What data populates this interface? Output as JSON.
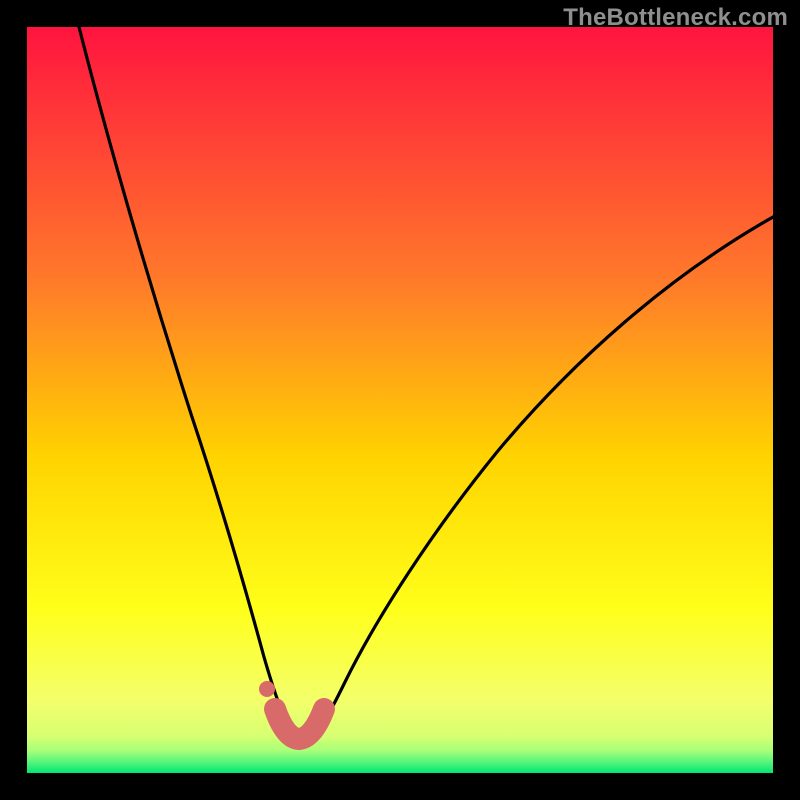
{
  "attribution": "TheBottleneck.com",
  "colors": {
    "black_frame": "#000000",
    "gradient_top": "#ff143f",
    "gradient_mid1": "#ff7a2a",
    "gradient_mid2": "#ffd400",
    "gradient_mid3": "#ffff1a",
    "gradient_low": "#f4ff6a",
    "gradient_green": "#00e873",
    "curve": "#000000",
    "marker": "#d86b6a"
  },
  "chart_data": {
    "type": "line",
    "title": "",
    "xlabel": "",
    "ylabel": "",
    "xlim": [
      0,
      100
    ],
    "ylim": [
      0,
      100
    ],
    "series": [
      {
        "name": "bottleneck-curve",
        "x": [
          7,
          10,
          14,
          18,
          22,
          25,
          28,
          30,
          32,
          33.5,
          35,
          36.5,
          38,
          40,
          43,
          48,
          55,
          63,
          72,
          82,
          92,
          100
        ],
        "y": [
          100,
          90,
          78,
          65,
          50,
          38,
          26,
          18,
          11,
          7,
          5,
          5,
          7,
          11,
          18,
          27,
          36,
          45,
          54,
          62,
          68,
          72
        ]
      }
    ],
    "annotations": [
      {
        "name": "marker-dot",
        "shape": "circle",
        "x": 32.2,
        "y": 11.0,
        "r_pct": 1.1
      },
      {
        "name": "marker-nose",
        "shape": "rounded-segment",
        "x_from": 33.3,
        "y_from": 6.4,
        "x_to": 38.7,
        "y_to": 6.4,
        "width_pct": 3.0
      }
    ],
    "gradient_bands_y_pct": [
      {
        "stop": 0,
        "color": "#ff143f"
      },
      {
        "stop": 34,
        "color": "#ff7a2a"
      },
      {
        "stop": 58,
        "color": "#ffd400"
      },
      {
        "stop": 78,
        "color": "#ffff1a"
      },
      {
        "stop": 90,
        "color": "#f4ff6a"
      },
      {
        "stop": 97,
        "color": "#b6ff7a"
      },
      {
        "stop": 100,
        "color": "#00e873"
      }
    ]
  }
}
